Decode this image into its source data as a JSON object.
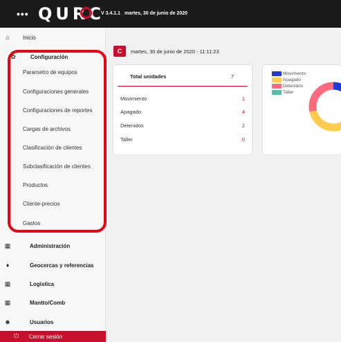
{
  "header": {
    "menu_icon": "ellipsis-icon",
    "logo_text": "QURC",
    "version": "V 3.4.1.1",
    "date": "martes, 30 de junio de 2020"
  },
  "sidebar": {
    "inicio": {
      "label": "Inicio",
      "icon": "home-icon"
    },
    "configuracion": {
      "label": "Configuración",
      "icon": "gear-icon"
    },
    "config_items": [
      "Parametro de equipos",
      "Configuraciones generales",
      "Configuraciones de reportes",
      "Cargas de archivos",
      "Clasificación de clientes",
      "Subclasificación de clientes",
      "Productos",
      "Cliente-precios",
      "Gastos"
    ],
    "administracion": {
      "label": "Administración",
      "icon": "grid-icon"
    },
    "geocercas": {
      "label": "Geocercas y referencias",
      "icon": "map-pin-icon"
    },
    "logistica": {
      "label": "Logística",
      "icon": "grid-icon"
    },
    "mantto": {
      "label": "Mantto/Comb",
      "icon": "grid-icon"
    },
    "usuarios": {
      "label": "Usuarios",
      "icon": "users-icon"
    },
    "cerrar": {
      "label": "Cerrar sesión",
      "icon": "power-icon"
    }
  },
  "main": {
    "refresh_label": "C",
    "datetime": "martes, 30 de junio de 2020 - 11:11:23",
    "totals": {
      "header": "Total unidades",
      "total": "7",
      "rows": [
        {
          "label": "Movimiento",
          "value": "1"
        },
        {
          "label": "Apagado",
          "value": "4"
        },
        {
          "label": "Detenidos",
          "value": "2"
        },
        {
          "label": "Taller",
          "value": "0"
        }
      ]
    }
  },
  "chart_data": {
    "type": "pie",
    "title": "",
    "legend_position": "top-left",
    "categories": [
      "Movimiento",
      "Apagado",
      "Detenidos",
      "Taller"
    ],
    "values": [
      1,
      4,
      2,
      0
    ],
    "colors": [
      "#1f3bd3",
      "#ffcc4d",
      "#ff6a7d",
      "#5cb8a7"
    ]
  }
}
